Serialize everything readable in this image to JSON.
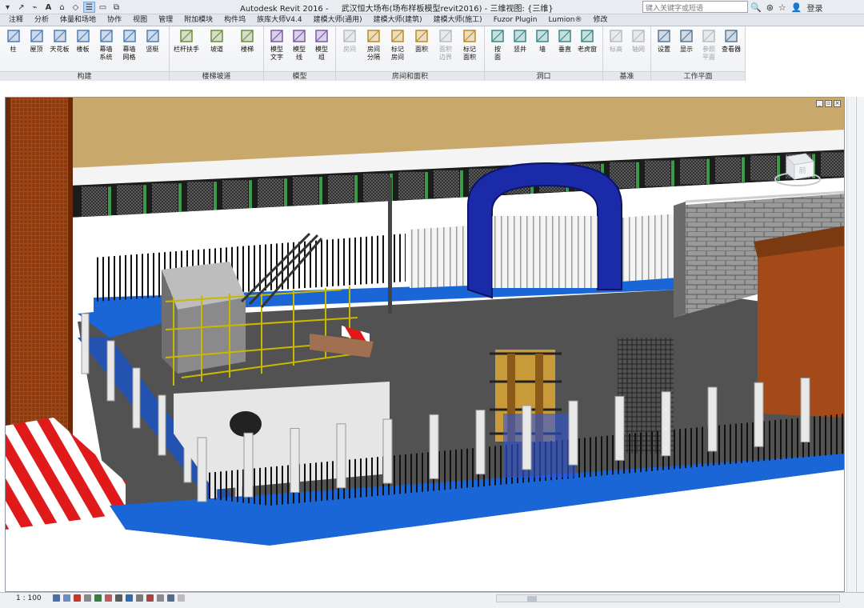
{
  "app": {
    "title": "Autodesk Revit 2016 -",
    "document": "武汉恒大场布(场布样板模型revit2016) - 三维视图: {三维}",
    "search_placeholder": "键入关键字或短语",
    "login": "登录"
  },
  "tabs": [
    "注释",
    "分析",
    "体量和场地",
    "协作",
    "视图",
    "管理",
    "附加模块",
    "构件坞",
    "族库大师V4.4",
    "建模大师(通用)",
    "建模大师(建筑)",
    "建模大师(施工)",
    "Fuzor Plugin",
    "Lumion®",
    "修改"
  ],
  "ribbon": {
    "panels": [
      {
        "label": "构建",
        "buttons": [
          {
            "label": "柱",
            "icon": "column-icon"
          },
          {
            "label": "屋顶",
            "icon": "roof-icon"
          },
          {
            "label": "天花板",
            "icon": "ceiling-icon"
          },
          {
            "label": "楼板",
            "icon": "floor-icon"
          },
          {
            "label": "幕墙\n系统",
            "icon": "curtain-system-icon"
          },
          {
            "label": "幕墙\n网格",
            "icon": "curtain-grid-icon"
          },
          {
            "label": "竖梃",
            "icon": "mullion-icon"
          }
        ]
      },
      {
        "label": "楼梯坡道",
        "buttons": [
          {
            "label": "栏杆扶手",
            "icon": "railing-icon"
          },
          {
            "label": "坡道",
            "icon": "ramp-icon"
          },
          {
            "label": "楼梯",
            "icon": "stair-icon"
          }
        ]
      },
      {
        "label": "模型",
        "buttons": [
          {
            "label": "模型\n文字",
            "icon": "model-text-icon"
          },
          {
            "label": "模型\n线",
            "icon": "model-line-icon"
          },
          {
            "label": "模型\n组",
            "icon": "model-group-icon"
          }
        ]
      },
      {
        "label": "房间和面积",
        "buttons": [
          {
            "label": "房间",
            "icon": "room-icon",
            "disabled": true
          },
          {
            "label": "房间\n分隔",
            "icon": "room-separator-icon"
          },
          {
            "label": "标记\n房间",
            "icon": "tag-room-icon"
          },
          {
            "label": "面积",
            "icon": "area-icon"
          },
          {
            "label": "面积\n边界",
            "icon": "area-boundary-icon",
            "disabled": true
          },
          {
            "label": "标记\n面积",
            "icon": "tag-area-icon"
          }
        ]
      },
      {
        "label": "洞口",
        "buttons": [
          {
            "label": "按\n面",
            "icon": "by-face-icon"
          },
          {
            "label": "竖井",
            "icon": "shaft-icon"
          },
          {
            "label": "墙",
            "icon": "wall-opening-icon"
          },
          {
            "label": "垂直",
            "icon": "vertical-icon"
          },
          {
            "label": "老虎窗",
            "icon": "dormer-icon"
          }
        ]
      },
      {
        "label": "基准",
        "buttons": [
          {
            "label": "标高",
            "icon": "level-icon",
            "disabled": true
          },
          {
            "label": "轴网",
            "icon": "grid-icon",
            "disabled": true
          }
        ]
      },
      {
        "label": "工作平面",
        "buttons": [
          {
            "label": "设置",
            "icon": "set-workplane-icon"
          },
          {
            "label": "显示",
            "icon": "show-workplane-icon"
          },
          {
            "label": "参照\n平面",
            "icon": "ref-plane-icon",
            "disabled": true
          },
          {
            "label": "查看器",
            "icon": "viewer-icon"
          }
        ]
      }
    ]
  },
  "viewcube": {
    "face": "前"
  },
  "status": {
    "scale": "1 : 100"
  },
  "colors": {
    "ground": "#555555",
    "ceiling": "#c8a86a",
    "crane": "#8a3a12",
    "gate": "#1a2aa8",
    "fence_base": "#1a66d6"
  }
}
